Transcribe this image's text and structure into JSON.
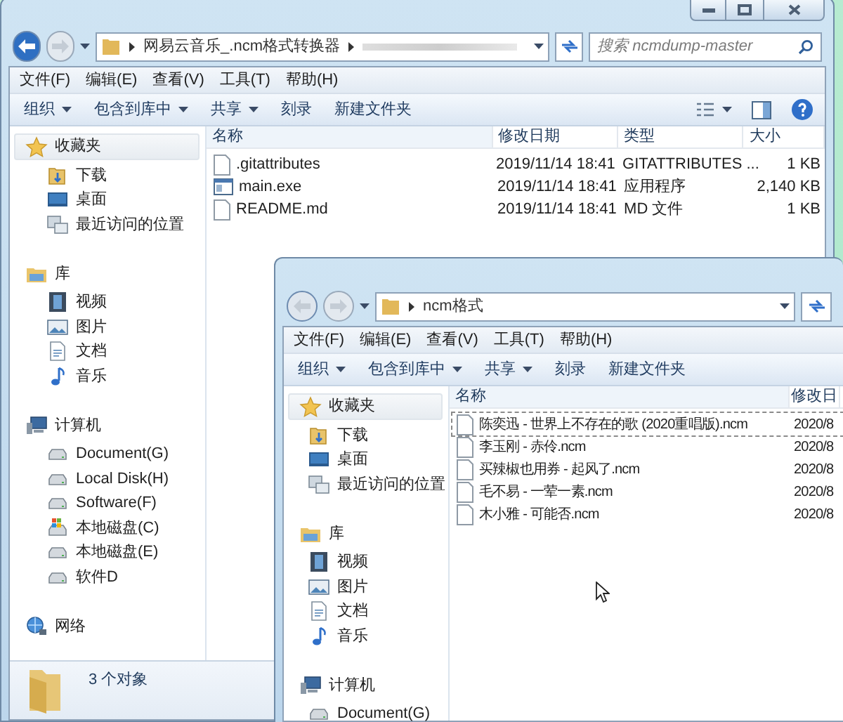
{
  "windows": [
    {
      "caption_buttons": true,
      "address": {
        "path": [
          "网易云音乐_.ncm格式转换器"
        ],
        "obscured_segment": true
      },
      "search": {
        "placeholder": "搜索 ncmdump-master"
      },
      "menu": [
        "文件(F)",
        "编辑(E)",
        "查看(V)",
        "工具(T)",
        "帮助(H)"
      ],
      "toolbar": [
        {
          "label": "组织",
          "dropdown": true
        },
        {
          "label": "包含到库中",
          "dropdown": true
        },
        {
          "label": "共享",
          "dropdown": true
        },
        {
          "label": "刻录",
          "dropdown": false
        },
        {
          "label": "新建文件夹",
          "dropdown": false
        }
      ],
      "view_controls": true,
      "sidebar": [
        {
          "label": "收藏夹",
          "kind": "favorites",
          "selected": true,
          "children": [
            {
              "label": "下载",
              "kind": "downloads"
            },
            {
              "label": "桌面",
              "kind": "desktop"
            },
            {
              "label": "最近访问的位置",
              "kind": "recent"
            }
          ]
        },
        {
          "label": "库",
          "kind": "library",
          "selected": false,
          "children": [
            {
              "label": "视频",
              "kind": "video"
            },
            {
              "label": "图片",
              "kind": "pictures"
            },
            {
              "label": "文档",
              "kind": "documents"
            },
            {
              "label": "音乐",
              "kind": "music"
            }
          ]
        },
        {
          "label": "计算机",
          "kind": "computer",
          "selected": false,
          "children": [
            {
              "label": "Document(G)",
              "kind": "drive"
            },
            {
              "label": "Local Disk(H)",
              "kind": "drive"
            },
            {
              "label": "Software(F)",
              "kind": "drive"
            },
            {
              "label": "本地磁盘(C)",
              "kind": "system-drive"
            },
            {
              "label": "本地磁盘(E)",
              "kind": "drive"
            },
            {
              "label": "软件D",
              "kind": "drive"
            }
          ]
        },
        {
          "label": "网络",
          "kind": "network",
          "selected": false
        }
      ],
      "columns": [
        "名称",
        "修改日期",
        "类型",
        "大小"
      ],
      "files": [
        {
          "kind": "document",
          "focused": false,
          "cells": [
            ".gitattributes",
            "2019/11/14 18:41",
            "GITATTRIBUTES ...",
            "1 KB"
          ]
        },
        {
          "kind": "program",
          "focused": false,
          "cells": [
            "main.exe",
            "2019/11/14 18:41",
            "应用程序",
            "2,140 KB"
          ]
        },
        {
          "kind": "document",
          "focused": false,
          "cells": [
            "README.md",
            "2019/11/14 18:41",
            "MD 文件",
            "1 KB"
          ]
        }
      ],
      "status": "3 个对象",
      "mouse_pointer": false
    },
    {
      "caption_buttons": false,
      "address": {
        "path": [
          "ncm格式"
        ],
        "obscured_segment": false
      },
      "menu": [
        "文件(F)",
        "编辑(E)",
        "查看(V)",
        "工具(T)",
        "帮助(H)"
      ],
      "toolbar": [
        {
          "label": "组织",
          "dropdown": true
        },
        {
          "label": "包含到库中",
          "dropdown": true
        },
        {
          "label": "共享",
          "dropdown": true
        },
        {
          "label": "刻录",
          "dropdown": false
        },
        {
          "label": "新建文件夹",
          "dropdown": false
        }
      ],
      "view_controls": false,
      "sidebar": [
        {
          "label": "收藏夹",
          "kind": "favorites",
          "selected": true,
          "children": [
            {
              "label": "下载",
              "kind": "downloads"
            },
            {
              "label": "桌面",
              "kind": "desktop"
            },
            {
              "label": "最近访问的位置",
              "kind": "recent"
            }
          ]
        },
        {
          "label": "库",
          "kind": "library",
          "selected": false,
          "children": [
            {
              "label": "视频",
              "kind": "video"
            },
            {
              "label": "图片",
              "kind": "pictures"
            },
            {
              "label": "文档",
              "kind": "documents"
            },
            {
              "label": "音乐",
              "kind": "music"
            }
          ]
        },
        {
          "label": "计算机",
          "kind": "computer",
          "selected": false,
          "children": [
            {
              "label": "Document(G)",
              "kind": "drive"
            }
          ]
        }
      ],
      "columns": [
        "名称",
        "修改日"
      ],
      "files": [
        {
          "kind": "document",
          "focused": true,
          "cells": [
            "陈奕迅 - 世界上不存在的歌 (2020重唱版).ncm",
            "2020/8"
          ]
        },
        {
          "kind": "document",
          "focused": false,
          "cells": [
            "李玉刚 - 赤伶.ncm",
            "2020/8"
          ]
        },
        {
          "kind": "document",
          "focused": false,
          "cells": [
            "买辣椒也用券 - 起风了.ncm",
            "2020/8"
          ]
        },
        {
          "kind": "document",
          "focused": false,
          "cells": [
            "毛不易 - 一荤一素.ncm",
            "2020/8"
          ]
        },
        {
          "kind": "document",
          "focused": false,
          "cells": [
            "木小雅 - 可能否.ncm",
            "2020/8"
          ]
        }
      ],
      "mouse_pointer": true
    }
  ]
}
